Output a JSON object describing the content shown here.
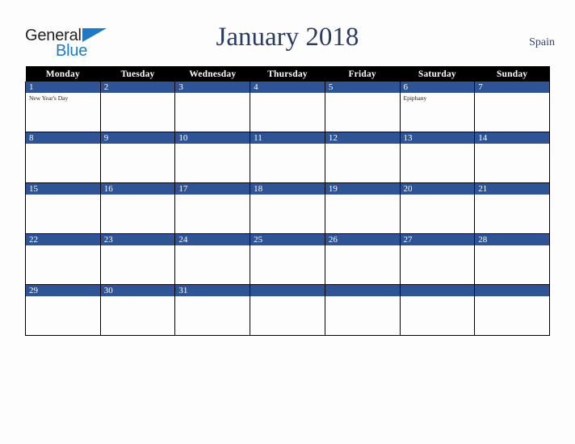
{
  "brand": {
    "name_part1": "General",
    "name_part2": "Blue",
    "triangle_icon": "triangle-icon",
    "color_dark": "#231f20",
    "color_blue": "#1e7ac4"
  },
  "header": {
    "title": "January 2018",
    "country": "Spain",
    "title_color": "#2a3c62"
  },
  "calendar": {
    "accent_color": "#2f5496",
    "header_bg": "#000000",
    "weekdays": [
      "Monday",
      "Tuesday",
      "Wednesday",
      "Thursday",
      "Friday",
      "Saturday",
      "Sunday"
    ],
    "weeks": [
      [
        {
          "day": "1",
          "events": [
            "New Year's Day"
          ]
        },
        {
          "day": "2",
          "events": []
        },
        {
          "day": "3",
          "events": []
        },
        {
          "day": "4",
          "events": []
        },
        {
          "day": "5",
          "events": []
        },
        {
          "day": "6",
          "events": [
            "Epiphany"
          ]
        },
        {
          "day": "7",
          "events": []
        }
      ],
      [
        {
          "day": "8",
          "events": []
        },
        {
          "day": "9",
          "events": []
        },
        {
          "day": "10",
          "events": []
        },
        {
          "day": "11",
          "events": []
        },
        {
          "day": "12",
          "events": []
        },
        {
          "day": "13",
          "events": []
        },
        {
          "day": "14",
          "events": []
        }
      ],
      [
        {
          "day": "15",
          "events": []
        },
        {
          "day": "16",
          "events": []
        },
        {
          "day": "17",
          "events": []
        },
        {
          "day": "18",
          "events": []
        },
        {
          "day": "19",
          "events": []
        },
        {
          "day": "20",
          "events": []
        },
        {
          "day": "21",
          "events": []
        }
      ],
      [
        {
          "day": "22",
          "events": []
        },
        {
          "day": "23",
          "events": []
        },
        {
          "day": "24",
          "events": []
        },
        {
          "day": "25",
          "events": []
        },
        {
          "day": "26",
          "events": []
        },
        {
          "day": "27",
          "events": []
        },
        {
          "day": "28",
          "events": []
        }
      ],
      [
        {
          "day": "29",
          "events": []
        },
        {
          "day": "30",
          "events": []
        },
        {
          "day": "31",
          "events": []
        },
        {
          "day": "",
          "events": []
        },
        {
          "day": "",
          "events": []
        },
        {
          "day": "",
          "events": []
        },
        {
          "day": "",
          "events": []
        }
      ]
    ]
  }
}
